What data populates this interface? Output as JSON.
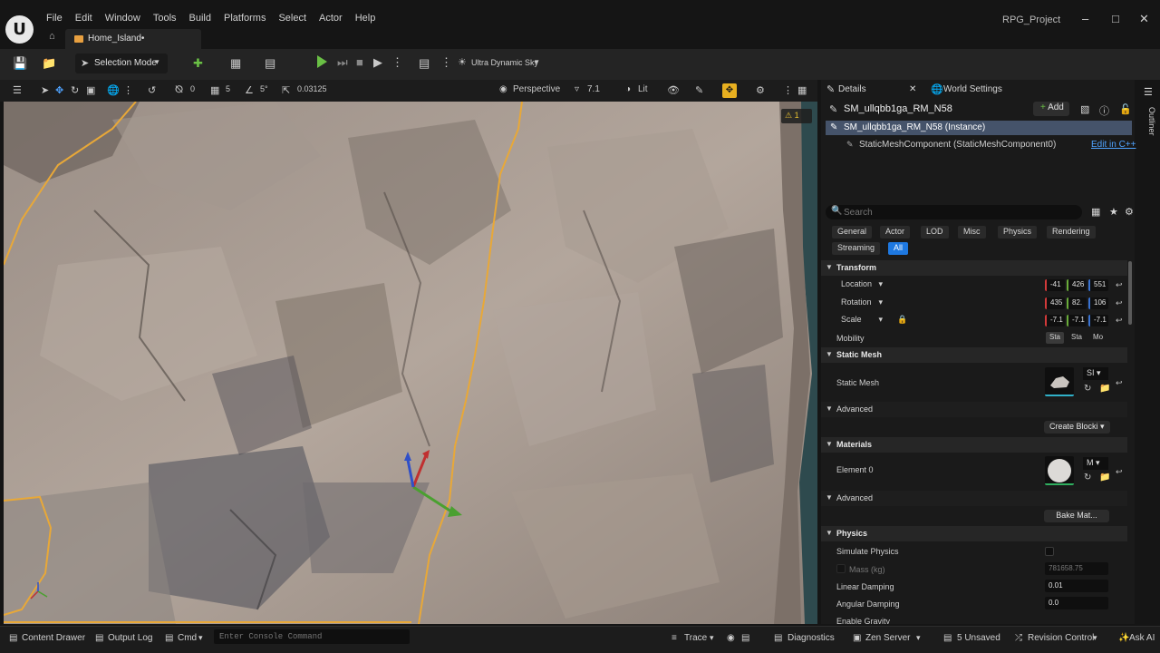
{
  "menu": {
    "items": [
      "File",
      "Edit",
      "Window",
      "Tools",
      "Build",
      "Platforms",
      "Select",
      "Actor",
      "Help"
    ],
    "project_name": "RPG_Project",
    "level_tab": "Home_Island•"
  },
  "toolbar": {
    "selection_mode": "Selection Mode",
    "sky_label": "Ultra Dynamic Sky"
  },
  "viewport_toolbar": {
    "rotate_snap_count": "0",
    "grid_snap": "5",
    "angle_snap": "5°",
    "scale_snap": "0.03125",
    "perspective": "Perspective",
    "fov": "7.1",
    "view_mode": "Lit",
    "warning_count": "1"
  },
  "details": {
    "tab_details": "Details",
    "tab_world": "World Settings",
    "actor_name": "SM_ullqbb1ga_RM_N58",
    "add_label": "Add",
    "instance_label": "SM_ullqbb1ga_RM_N58 (Instance)",
    "component_label": "StaticMeshComponent (StaticMeshComponent0)",
    "edit_cpp": "Edit in C++",
    "search_placeholder": "Search",
    "filters": [
      "General",
      "Actor",
      "LOD",
      "Misc",
      "Physics",
      "Rendering",
      "Streaming",
      "All"
    ],
    "transform": {
      "section": "Transform",
      "location_label": "Location",
      "location": [
        "-41",
        "426",
        "551"
      ],
      "rotation_label": "Rotation",
      "rotation": [
        "435",
        "82.",
        "106"
      ],
      "scale_label": "Scale",
      "scale": [
        "-7.1",
        "-7.1",
        "-7.1"
      ],
      "mobility_label": "Mobility",
      "mobility_options": [
        "Sta",
        "Sta",
        "Mo"
      ]
    },
    "static_mesh": {
      "section": "Static Mesh",
      "label": "Static Mesh",
      "value": "SI",
      "advanced": "Advanced",
      "create_blocking": "Create Blocki"
    },
    "materials": {
      "section": "Materials",
      "element_label": "Element 0",
      "value": "M",
      "advanced": "Advanced",
      "bake": "Bake Mat..."
    },
    "physics": {
      "section": "Physics",
      "simulate": "Simulate Physics",
      "mass_label": "Mass (kg)",
      "mass_value": "781658.75",
      "linear_label": "Linear Damping",
      "linear_value": "0.01",
      "angular_label": "Angular Damping",
      "angular_value": "0.0",
      "gravity_label": "Enable Gravity"
    },
    "outliner_label": "Outliner"
  },
  "statusbar": {
    "content_drawer": "Content Drawer",
    "output_log": "Output Log",
    "cmd": "Cmd",
    "console_placeholder": "Enter Console Command",
    "trace": "Trace",
    "diagnostics": "Diagnostics",
    "zen_server": "Zen Server",
    "unsaved": "5 Unsaved",
    "revision_control": "Revision Control",
    "ask_ai": "Ask AI"
  },
  "colors": {
    "accent": "#1e78e0",
    "play_green": "#6ac045",
    "selection_outline": "#e8a838",
    "panel_bg": "#1a1a1a"
  }
}
